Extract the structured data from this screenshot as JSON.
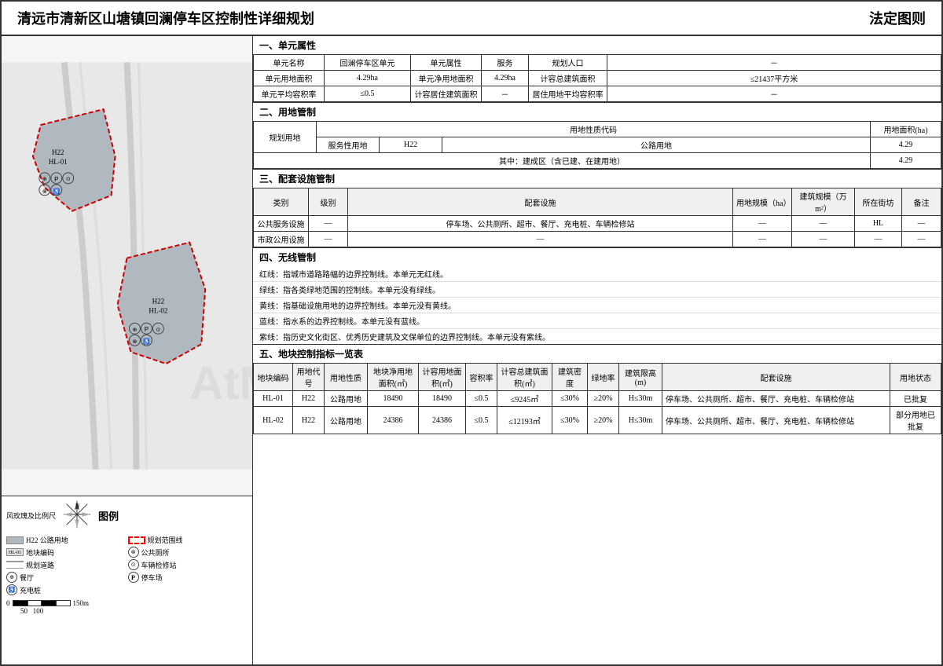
{
  "header": {
    "title": "清远市清新区山塘镇回澜停车区控制性详细规划",
    "right_label": "法定图则"
  },
  "sections": {
    "s1": {
      "title": "一、单元属性",
      "table1": {
        "rows": [
          [
            "单元名称",
            "回澜停车区单元",
            "单元属性",
            "服务",
            "规划人口",
            "－"
          ],
          [
            "单元用地面积",
            "4.29ha",
            "单元净用地面积",
            "4.29ha",
            "计容总建筑面积",
            "≤21437平方米"
          ],
          [
            "单元平均容积率",
            "≤0.5",
            "计容居住建筑面积",
            "－",
            "居住用地平均容积率",
            "－"
          ]
        ]
      }
    },
    "s2": {
      "title": "二、用地管制",
      "table_head": [
        "规划用地",
        "用地性质代码",
        "",
        "",
        "用地面积(ha)"
      ],
      "rows": [
        [
          "服务性用地",
          "H22",
          "公路用地",
          "4.29"
        ],
        [
          "其中：建成区（含已建、在建用地）",
          "—",
          "",
          "4.29"
        ]
      ]
    },
    "s3": {
      "title": "三、配套设施管制",
      "headers": [
        "类别",
        "级别",
        "配套设施",
        "用地规模（ha）",
        "建筑规模（万m²）",
        "所在街坊",
        "备注"
      ],
      "rows": [
        [
          "公共服务设施",
          "—",
          "停车场、公共厕所、超市、餐厅、充电桩、车辆检修站",
          "—",
          "—",
          "HL",
          "—"
        ],
        [
          "市政公用设施",
          "—",
          "—",
          "—",
          "—",
          "—",
          "—"
        ]
      ]
    },
    "s4": {
      "title": "四、无线管制",
      "lines": [
        "红线：指城市道路路幅的边界控制线。本单元无红线。",
        "绿线：指各类绿地范围的控制线。本单元没有绿线。",
        "黄线：指基础设施用地的边界控制线。本单元没有黄线。",
        "蓝线：指水系的边界控制线。本单元没有蓝线。",
        "紫线：指历史文化街区、优秀历史建筑及文保单位的边界控制线。本单元没有紫线。"
      ]
    },
    "s5": {
      "title": "五、地块控制指标一览表",
      "headers": [
        "地块编码",
        "用地代号",
        "用地性质",
        "地块净用地面积(㎡)",
        "计容用地面积(㎡)",
        "容积率",
        "计容总建筑面积(㎡)",
        "建筑密度",
        "绿地率",
        "建筑限高(m)",
        "配套设施",
        "用地状态"
      ],
      "rows": [
        [
          "HL-01",
          "H22",
          "公路用地",
          "18490",
          "18490",
          "≤0.5",
          "≤9245㎡",
          "≤30%",
          "≥20%",
          "H≤30m",
          "停车场、公共厕所、超市、餐厅、充电桩、车辆检修站",
          "已批复"
        ],
        [
          "HL-02",
          "H22",
          "公路用地",
          "24386",
          "24386",
          "≤0.5",
          "≤12193㎡",
          "≤30%",
          "≥20%",
          "H≤30m",
          "停车场、公共厕所、超市、餐厅、充电桩、车辆检修站",
          "部分用地已批复"
        ]
      ]
    }
  },
  "legend": {
    "title": "图例",
    "wind_rose_label": "风玫瑰及比例尺",
    "items": [
      {
        "symbol": "H22-box",
        "label": "公路用地"
      },
      {
        "symbol": "dashed-red",
        "label": "规划范围线"
      },
      {
        "symbol": "toilet-icon",
        "label": "公共厕所"
      },
      {
        "symbol": "HL-01-box",
        "label": "地块编码"
      },
      {
        "symbol": "car-repair-icon",
        "label": "车辆检修站"
      },
      {
        "symbol": "parking-icon",
        "label": "停车场"
      },
      {
        "symbol": "road-line",
        "label": "规划道路"
      },
      {
        "symbol": "restaurant-icon",
        "label": "餐厅"
      },
      {
        "symbol": "charge-icon",
        "label": "充电桩"
      }
    ],
    "scale": "0  50  100    150m"
  },
  "map": {
    "block1_label": "H22\nHL-01",
    "block2_label": "H22\nHL-02",
    "block1_icons": [
      "⊕",
      "P",
      "⊙",
      "♿"
    ],
    "block2_icons": [
      "⊕",
      "P",
      "⊙",
      "♿"
    ]
  }
}
